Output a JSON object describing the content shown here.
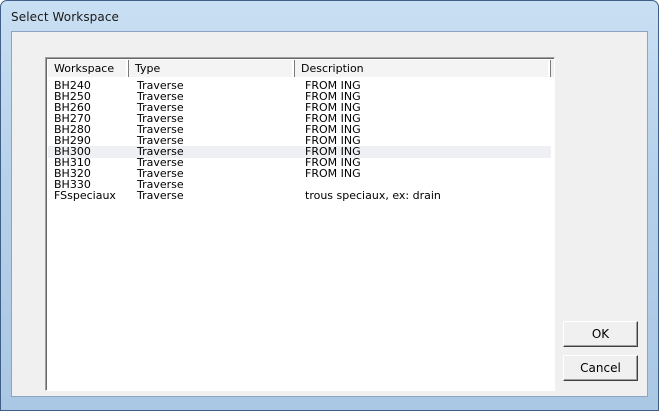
{
  "window": {
    "title": "Select Workspace"
  },
  "list": {
    "columns": [
      "Workspace",
      "Type",
      "Description"
    ],
    "rows": [
      {
        "workspace": "BH240",
        "type": "Traverse",
        "description": "FROM ING"
      },
      {
        "workspace": "BH250",
        "type": "Traverse",
        "description": "FROM ING"
      },
      {
        "workspace": "BH260",
        "type": "Traverse",
        "description": "FROM ING"
      },
      {
        "workspace": "BH270",
        "type": "Traverse",
        "description": "FROM ING"
      },
      {
        "workspace": "BH280",
        "type": "Traverse",
        "description": "FROM ING"
      },
      {
        "workspace": "BH290",
        "type": "Traverse",
        "description": "FROM ING"
      },
      {
        "workspace": "BH300",
        "type": "Traverse",
        "description": "FROM ING"
      },
      {
        "workspace": "BH310",
        "type": "Traverse",
        "description": "FROM ING"
      },
      {
        "workspace": "BH320",
        "type": "Traverse",
        "description": "FROM ING"
      },
      {
        "workspace": "BH330",
        "type": "Traverse",
        "description": ""
      },
      {
        "workspace": "FSspeciaux",
        "type": "Traverse",
        "description": "trous speciaux, ex: drain"
      }
    ]
  },
  "buttons": {
    "ok": "OK",
    "cancel": "Cancel"
  }
}
